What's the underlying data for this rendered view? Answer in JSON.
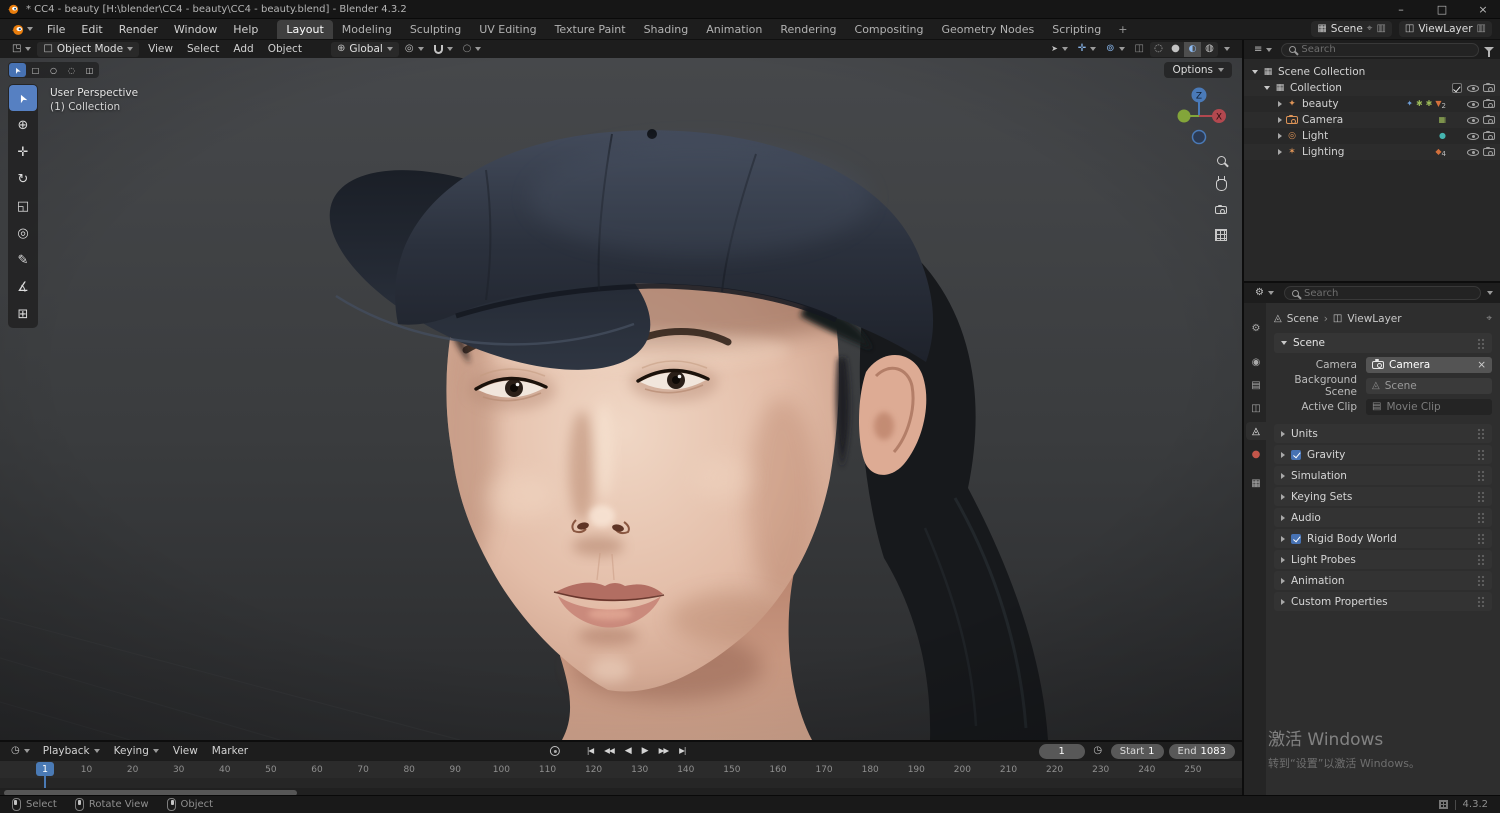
{
  "window": {
    "title": "* CC4 - beauty [H:\\blender\\CC4 - beauty\\CC4 - beauty.blend] - Blender 4.3.2",
    "minimize": "–",
    "maximize": "□",
    "close": "×"
  },
  "icons": {
    "editor_3d": "◳",
    "editor_outliner": "≡",
    "editor_properties": "⚙",
    "editor_timeline": "◷",
    "object_mode": "□",
    "globe": "⊕",
    "pivot": "◎",
    "proportional": "○",
    "pointer": "➤",
    "gizmo": "✛",
    "overlays": "⊚",
    "xray": "◫",
    "shading_wireframe": "◌",
    "shading_solid": "●",
    "shading_material": "◐",
    "shading_rendered": "◍",
    "scene_block": "▦",
    "view_layer": "◫",
    "duplicate": "▥",
    "pin": "⌖",
    "collection": "▦",
    "armature": "✦",
    "light": "◎",
    "empty": "✶",
    "armature_data": "✦",
    "mesh_data": "✱",
    "material_data": "▼",
    "image_data": "▦",
    "light_data": "●",
    "instance": "◆",
    "scene_prop": "◬",
    "clip": "▤",
    "stopwatch": "◷"
  },
  "menubar": {
    "menus": [
      {
        "label": "File"
      },
      {
        "label": "Edit"
      },
      {
        "label": "Render"
      },
      {
        "label": "Window"
      },
      {
        "label": "Help"
      }
    ],
    "workspaces": [
      {
        "label": "Layout",
        "cls": "active"
      },
      {
        "label": "Modeling"
      },
      {
        "label": "Sculpting"
      },
      {
        "label": "UV Editing"
      },
      {
        "label": "Texture Paint"
      },
      {
        "label": "Shading"
      },
      {
        "label": "Animation"
      },
      {
        "label": "Rendering"
      },
      {
        "label": "Compositing"
      },
      {
        "label": "Geometry Nodes"
      },
      {
        "label": "Scripting"
      }
    ],
    "add_tab": "+",
    "scene": "Scene",
    "viewlayer": "ViewLayer"
  },
  "viewport": {
    "mode": "Object Mode",
    "menus": [
      {
        "label": "View"
      },
      {
        "label": "Select"
      },
      {
        "label": "Add"
      },
      {
        "label": "Object"
      }
    ],
    "orientation": "Global",
    "overlay": {
      "perspective": "User Perspective",
      "collection": "(1) Collection",
      "options": "Options"
    },
    "gizmo": {
      "x": "X",
      "z": "Z"
    },
    "select_modes": [
      {
        "name": "tweak",
        "glyph": "➤",
        "cls": "active"
      },
      {
        "name": "select-box",
        "glyph": "□"
      },
      {
        "name": "select-circle",
        "glyph": "○"
      },
      {
        "name": "select-lasso",
        "glyph": "◌"
      },
      {
        "name": "select-intersect",
        "glyph": "◫"
      }
    ],
    "tools": [
      {
        "name": "select-box",
        "glyph": "➤",
        "cls": "active"
      },
      {
        "name": "cursor",
        "glyph": "⊕"
      },
      {
        "name": "move",
        "glyph": "✛"
      },
      {
        "name": "rotate",
        "glyph": "↻"
      },
      {
        "name": "scale",
        "glyph": "◱"
      },
      {
        "name": "transform",
        "glyph": "◎"
      },
      {
        "name": "annotate",
        "glyph": "✎"
      },
      {
        "name": "measure",
        "glyph": "∡"
      },
      {
        "name": "add-cube",
        "glyph": "⊞"
      }
    ]
  },
  "outliner": {
    "search_placeholder": "Search",
    "rows": [
      {
        "label": "Scene Collection"
      },
      {
        "label": "Collection"
      },
      {
        "label": "beauty",
        "badge": "2"
      },
      {
        "label": "Camera"
      },
      {
        "label": "Light"
      },
      {
        "label": "Lighting",
        "badge": "4"
      }
    ]
  },
  "properties": {
    "search_placeholder": "Search",
    "breadcrumb": {
      "scene": "Scene",
      "viewlayer": "ViewLayer"
    },
    "tabs": [
      {
        "name": "tool",
        "glyph": "⚙"
      },
      {
        "name": "render",
        "glyph": "◉"
      },
      {
        "name": "output",
        "glyph": "▤"
      },
      {
        "name": "view-layer",
        "glyph": "◫"
      },
      {
        "name": "scene",
        "glyph": "◬",
        "cls": "active"
      },
      {
        "name": "world",
        "glyph": "●",
        "cls": "red"
      },
      {
        "name": "collection",
        "glyph": "▦"
      }
    ],
    "scene_panel": {
      "title": "Scene",
      "camera_label": "Camera",
      "camera_value": "Camera",
      "clear": "×",
      "background_label": "Background Scene",
      "background_value": "Scene",
      "clip_label": "Active Clip",
      "clip_value": "Movie Clip"
    },
    "panels": [
      {
        "label": "Units"
      },
      {
        "label": "Gravity",
        "checkbox": true
      },
      {
        "label": "Simulation"
      },
      {
        "label": "Keying Sets"
      },
      {
        "label": "Audio"
      },
      {
        "label": "Rigid Body World",
        "checkbox": true
      },
      {
        "label": "Light Probes"
      },
      {
        "label": "Animation"
      },
      {
        "label": "Custom Properties"
      }
    ]
  },
  "timeline": {
    "menus": [
      {
        "label": "Playback",
        "cls": "drop"
      },
      {
        "label": "Keying",
        "cls": "drop"
      },
      {
        "label": "View"
      },
      {
        "label": "Marker"
      }
    ],
    "transport": [
      {
        "name": "jump-to-start",
        "glyph": "|◀"
      },
      {
        "name": "previous-keyframe",
        "glyph": "◀◀"
      },
      {
        "name": "play-reverse",
        "glyph": "◀",
        "cls": "play"
      },
      {
        "name": "play",
        "glyph": "▶",
        "cls": "play"
      },
      {
        "name": "next-keyframe",
        "glyph": "▶▶"
      },
      {
        "name": "jump-to-end",
        "glyph": "▶|"
      }
    ],
    "current_frame": "1",
    "start_label": "Start",
    "start_value": "1",
    "end_label": "End",
    "end_value": "1083",
    "ruler_frames": [
      10,
      20,
      30,
      40,
      50,
      60,
      70,
      80,
      90,
      100,
      110,
      120,
      130,
      140,
      150,
      160,
      170,
      180,
      190,
      200,
      210,
      220,
      230,
      240,
      250
    ]
  },
  "statusbar": {
    "items": [
      {
        "label": "Select",
        "cls": "m-left"
      },
      {
        "label": "Rotate View",
        "cls": "m-middle"
      },
      {
        "label": "Object",
        "cls": "m-right"
      }
    ],
    "version": "4.3.2"
  },
  "watermark": {
    "line1": "激活 Windows",
    "line2": "转到“设置”以激活 Windows。"
  }
}
